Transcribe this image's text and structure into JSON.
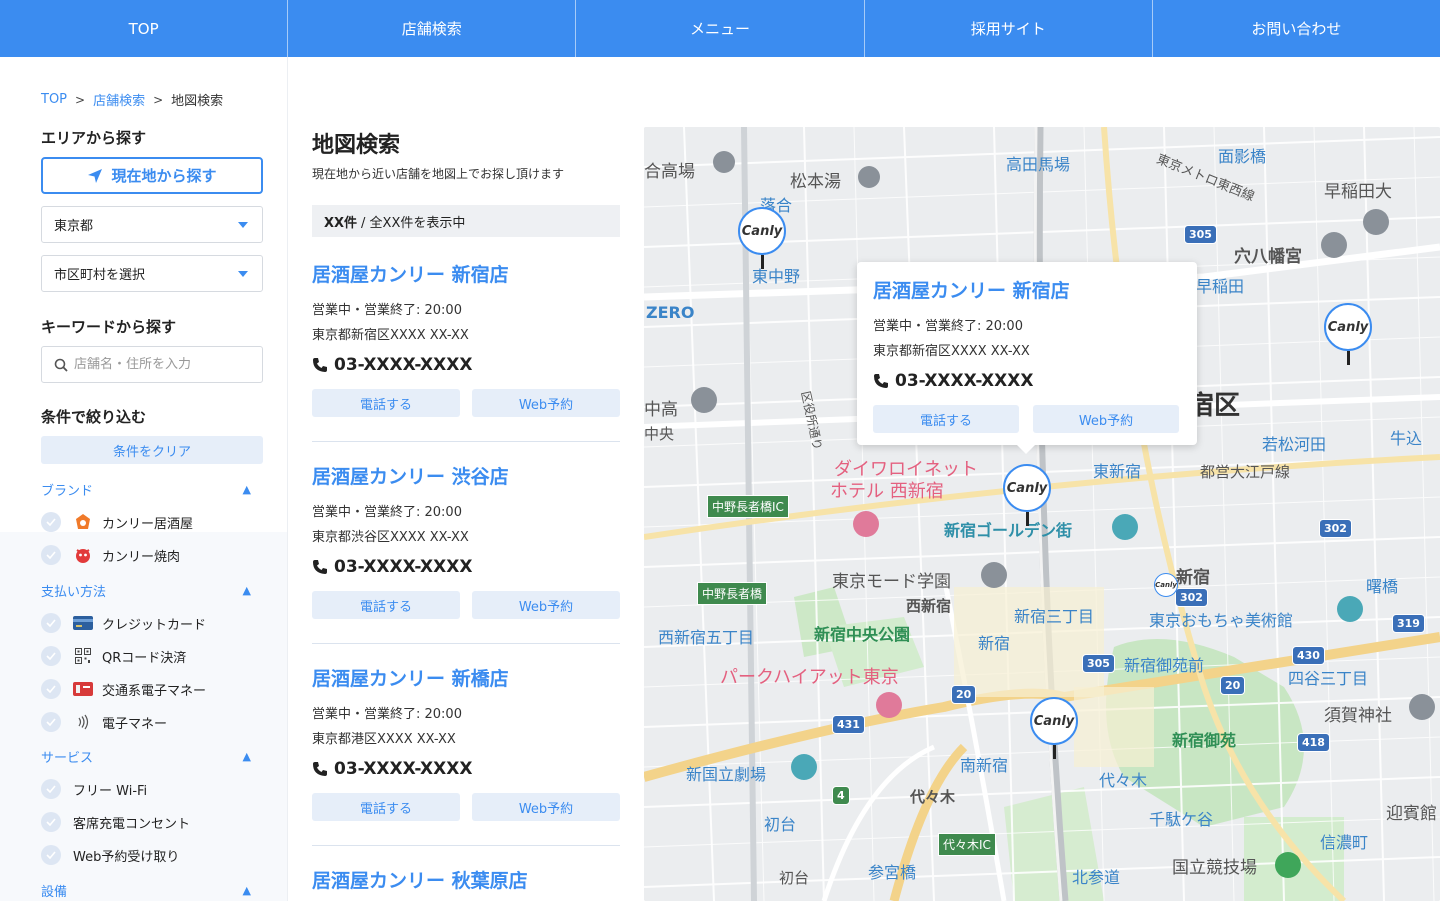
{
  "topnav": {
    "items": [
      "TOP",
      "店舗検索",
      "メニュー",
      "採用サイト",
      "お問い合わせ"
    ]
  },
  "breadcrumb": {
    "items": [
      "TOP",
      "店舗検索"
    ],
    "separator": ">",
    "current": "地図検索"
  },
  "sidebar": {
    "area_title": "エリアから探す",
    "locate_label": "現在地から探す",
    "prefecture_selected": "東京都",
    "city_selected": "市区町村を選択",
    "keyword_title": "キーワードから探す",
    "keyword_placeholder": "店舗名・住所を入力",
    "filter_title": "条件で絞り込む",
    "clear_label": "条件をクリア",
    "groups": [
      {
        "label": "ブランド",
        "options": [
          "カンリー居酒屋",
          "カンリー焼肉"
        ]
      },
      {
        "label": "支払い方法",
        "options": [
          "クレジットカード",
          "QRコード決済",
          "交通系電子マネー",
          "電子マネー"
        ]
      },
      {
        "label": "サービス",
        "options": [
          "フリー Wi-Fi",
          "客席充電コンセント",
          "Web予約受け取り"
        ]
      },
      {
        "label": "設備",
        "options": []
      }
    ]
  },
  "main": {
    "title": "地図検索",
    "description": "現在地から近い店舗を地図上でお探し頂けます",
    "count_bold": "XX件",
    "count_rest": "/ 全XX件を表示中"
  },
  "stores": [
    {
      "name": "居酒屋カンリー 新宿店",
      "status": "営業中・営業終了: 20:00",
      "address": "東京都新宿区XXXX XX-XX",
      "phone": "03-XXXX-XXXX",
      "call_label": "電話する",
      "reserve_label": "Web予約"
    },
    {
      "name": "居酒屋カンリー 渋谷店",
      "status": "営業中・営業終了: 20:00",
      "address": "東京都渋谷区XXXX XX-XX",
      "phone": "03-XXXX-XXXX",
      "call_label": "電話する",
      "reserve_label": "Web予約"
    },
    {
      "name": "居酒屋カンリー 新橋店",
      "status": "営業中・営業終了: 20:00",
      "address": "東京都港区XXXX XX-XX",
      "phone": "03-XXXX-XXXX",
      "call_label": "電話する",
      "reserve_label": "Web予約"
    },
    {
      "name": "居酒屋カンリー 秋葉原店"
    }
  ],
  "popup": {
    "name": "居酒屋カンリー 新宿店",
    "status": "営業中・営業終了: 20:00",
    "address": "東京都新宿区XXXX XX-XX",
    "phone": "03-XXXX-XXXX",
    "call_label": "電話する",
    "reserve_label": "Web予約"
  },
  "map": {
    "pin_label": "Canly",
    "labels": {
      "takadanobaba": "高田馬場",
      "matsumoto": "松本湯",
      "ochiai": "落合",
      "higashinakano": "東中野",
      "zero": "ZERO",
      "menkage": "面影橋",
      "waseda": "早稲田大",
      "anahachiman": "穴八幡宮",
      "wasedastation": "早稲田",
      "tokyometro": "東京メトロ東西線",
      "shinjukuku": "宿区",
      "kaigo": "合高場",
      "nakataka": "中高",
      "chuo": "中央",
      "wakamatsu": "若松河田",
      "higashishinjuku": "東新宿",
      "oedo": "都営大江戸線",
      "ushigome": "牛込",
      "daiwa": "ダイワロイネット",
      "hotel": "ホテル 西新宿",
      "golden": "新宿ゴールデン街",
      "nakanochoja_ic": "中野長者橋IC",
      "nakanochoja": "中野長者橋",
      "mode": "東京モード学園",
      "nishishinjuku": "西新宿",
      "shinjuku": "新宿",
      "sanchome": "新宿三丁目",
      "omocha": "東京おもちゃ美術館",
      "akebono": "曙橋",
      "nishishinjuku5": "西新宿五丁目",
      "chuokoen": "新宿中央公園",
      "shinjukuStation": "新宿",
      "gyoenmae": "新宿御苑前",
      "yotsuya3": "四谷三丁目",
      "park": "パークハイアット東京",
      "sugaga": "須賀神社",
      "gyoen": "新宿御苑",
      "minamishinjuku": "南新宿",
      "yoyogi": "代々木",
      "kokuritsu": "新国立劇場",
      "yoyogi2": "代々木",
      "hatsudai": "初台",
      "sendagaya": "千駄ケ谷",
      "geihinkan": "迎賓館",
      "shinanomachi": "信濃町",
      "sanguubashi": "参宮橋",
      "yoyogiic": "代々木IC",
      "hatsudai2": "初台",
      "kitasando": "北参道",
      "kyogijo": "国立競技場",
      "kuyakusho": "区役所通り"
    }
  },
  "colors": {
    "accent": "#3b8cf0",
    "button_bg": "#e6eef9"
  }
}
